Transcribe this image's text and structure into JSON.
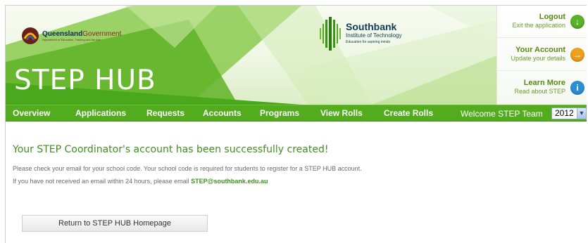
{
  "header": {
    "qld_brand_bold": "Queensland",
    "qld_brand_light": "Government",
    "qld_department": "Department of Education, Training and the Arts",
    "app_title": "STEP HUB",
    "southbank": {
      "name": "Southbank",
      "institute": "Institute of Technology",
      "tagline": "Education for aspiring minds"
    }
  },
  "side_links": [
    {
      "title": "Logout",
      "subtitle": "Exit the application",
      "icon": "arrow-down-icon",
      "color": "#58b32b"
    },
    {
      "title": "Your Account",
      "subtitle": "Update your details",
      "icon": "arrow-right-icon",
      "color": "#f0a020"
    },
    {
      "title": "Learn More",
      "subtitle": "Read about STEP",
      "icon": "info-icon",
      "color": "#2c8fd6"
    }
  ],
  "nav": {
    "items": [
      "Overview",
      "Applications",
      "Requests",
      "Accounts",
      "Programs",
      "View Rolls",
      "Create Rolls"
    ],
    "welcome": "Welcome STEP Team",
    "year": "2012"
  },
  "content": {
    "success_heading": "Your STEP Coordinator's account has been successfully created!",
    "line1": "Please check your email for your school code. Your school code is required for students to register for a STEP HUB account.",
    "line2_prefix": "If you have not received an email within 24 hours, please email ",
    "email": "STEP@southbank.edu.au",
    "return_button": "Return to STEP HUB Homepage"
  },
  "colors": {
    "nav_green": "#52ac1d",
    "accent_green": "#3f8f1f"
  }
}
